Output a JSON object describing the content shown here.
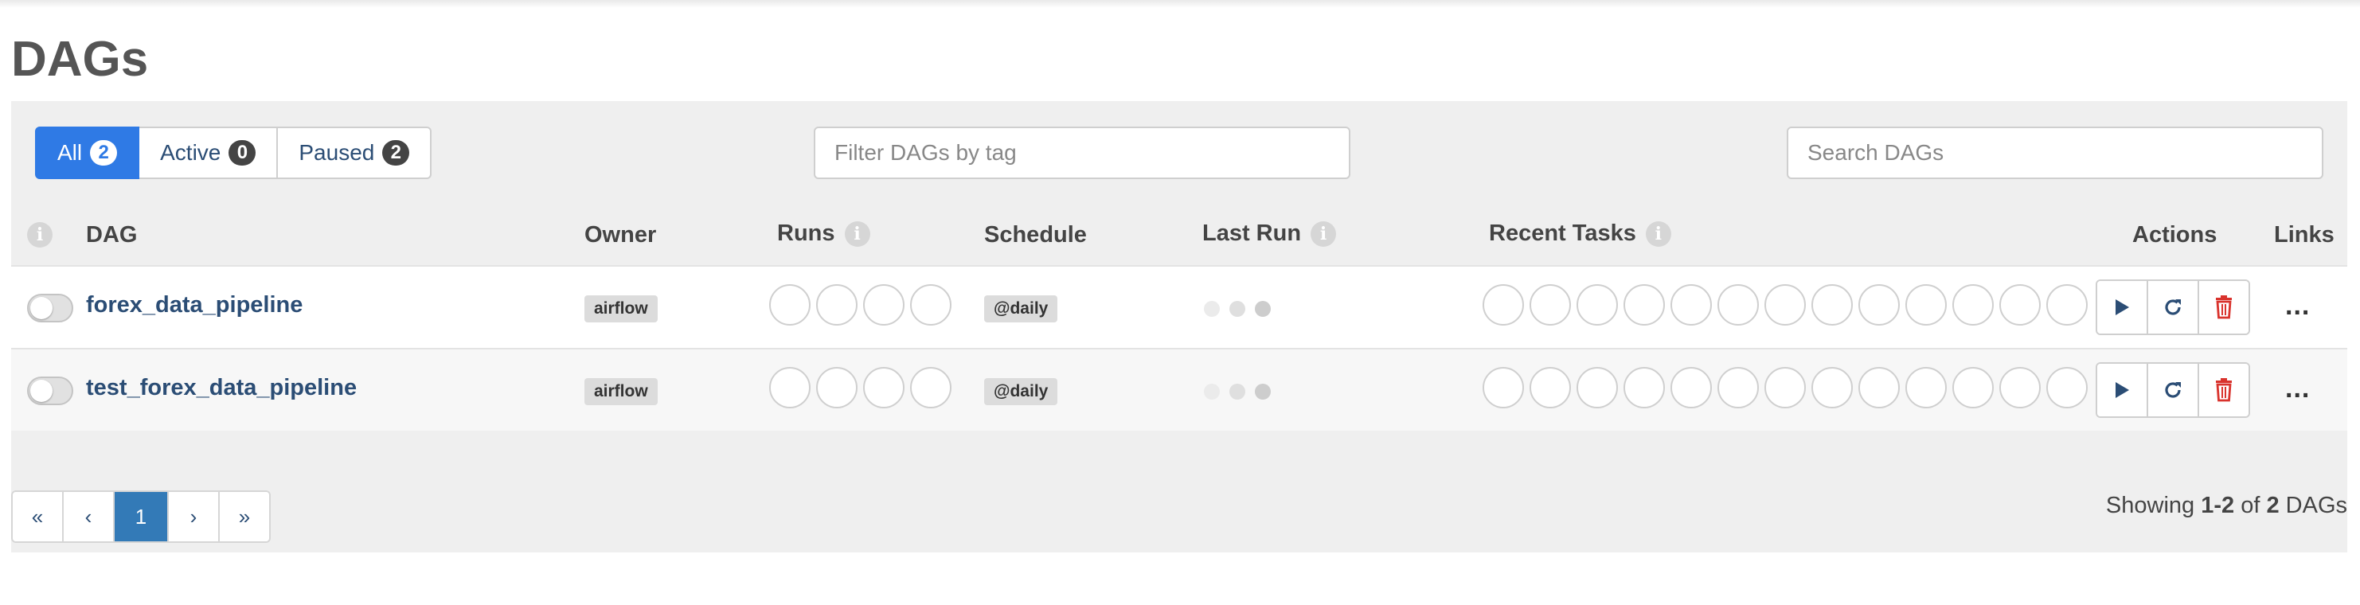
{
  "page": {
    "title": "DAGs"
  },
  "filters": {
    "tabs": [
      {
        "label": "All",
        "count": "2"
      },
      {
        "label": "Active",
        "count": "0"
      },
      {
        "label": "Paused",
        "count": "2"
      }
    ],
    "tag_placeholder": "Filter DAGs by tag",
    "search_placeholder": "Search DAGs"
  },
  "table": {
    "headers": {
      "dag": "DAG",
      "owner": "Owner",
      "runs": "Runs",
      "schedule": "Schedule",
      "last_run": "Last Run",
      "recent_tasks": "Recent Tasks",
      "actions": "Actions",
      "links": "Links"
    },
    "rows": [
      {
        "dag_id": "forex_data_pipeline",
        "owner": "airflow",
        "schedule": "@daily",
        "paused": true
      },
      {
        "dag_id": "test_forex_data_pipeline",
        "owner": "airflow",
        "schedule": "@daily",
        "paused": true
      }
    ],
    "more_links": "..."
  },
  "pagination": {
    "first": "«",
    "prev": "‹",
    "current": "1",
    "next": "›",
    "last": "»"
  },
  "showing": {
    "prefix": "Showing",
    "range": "1-2",
    "of": "of",
    "total": "2",
    "suffix": "DAGs"
  },
  "colors": {
    "accent": "#2f7ae5",
    "link": "#2b4d75",
    "delete": "#d9332d"
  }
}
